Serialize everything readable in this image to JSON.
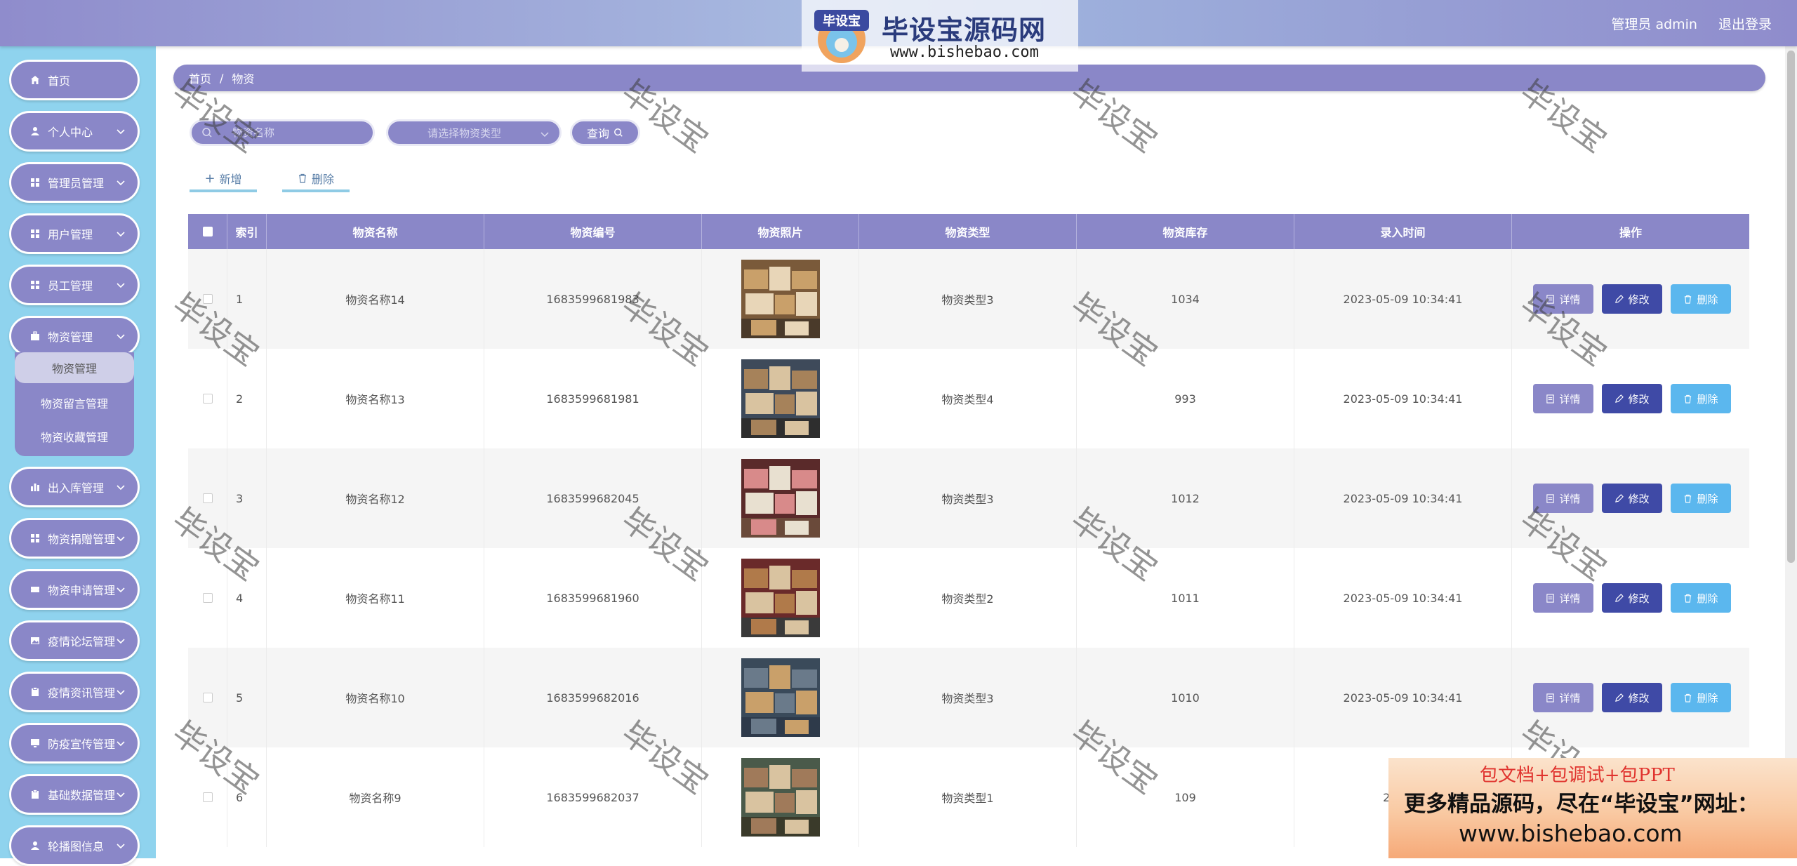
{
  "header": {
    "user_label": "管理员 admin",
    "logout_label": "退出登录",
    "logo_brand": "毕设宝源码网",
    "logo_url": "www.bishebao.com",
    "logo_badge": "毕设宝"
  },
  "sidebar": {
    "items": [
      {
        "label": "首页",
        "icon": "home-icon"
      },
      {
        "label": "个人中心",
        "icon": "user-icon"
      },
      {
        "label": "管理员管理",
        "icon": "grid-icon"
      },
      {
        "label": "用户管理",
        "icon": "grid-icon"
      },
      {
        "label": "员工管理",
        "icon": "grid-icon"
      },
      {
        "label": "物资管理",
        "icon": "briefcase-icon"
      },
      {
        "label": "出入库管理",
        "icon": "bar-chart-icon"
      },
      {
        "label": "物资捐赠管理",
        "icon": "grid-icon"
      },
      {
        "label": "物资申请管理",
        "icon": "ticket-icon"
      },
      {
        "label": "疫情论坛管理",
        "icon": "picture-icon"
      },
      {
        "label": "疫情资讯管理",
        "icon": "clipboard-icon"
      },
      {
        "label": "防疫宣传管理",
        "icon": "monitor-icon"
      },
      {
        "label": "基础数据管理",
        "icon": "clipboard-icon"
      },
      {
        "label": "轮播图信息",
        "icon": "user-icon"
      }
    ],
    "submenu": [
      {
        "label": "物资管理"
      },
      {
        "label": "物资留言管理"
      },
      {
        "label": "物资收藏管理"
      }
    ]
  },
  "breadcrumb": {
    "home": "首页",
    "separator": "/",
    "current": "物资"
  },
  "search": {
    "name_placeholder": "物资名称",
    "type_placeholder": "请选择物资类型",
    "query_label": "查询"
  },
  "actions": {
    "add_label": "新增",
    "delete_label": "删除"
  },
  "table": {
    "columns": [
      "索引",
      "物资名称",
      "物资编号",
      "物资照片",
      "物资类型",
      "物资库存",
      "录入时间",
      "操作"
    ],
    "buttons": {
      "detail": "详情",
      "edit": "修改",
      "delete": "删除"
    },
    "rows": [
      {
        "index": "1",
        "name": "物资名称14",
        "code": "1683599681983",
        "type": "物资类型3",
        "stock": "1034",
        "time": "2023-05-09 10:34:41"
      },
      {
        "index": "2",
        "name": "物资名称13",
        "code": "1683599681981",
        "type": "物资类型4",
        "stock": "993",
        "time": "2023-05-09 10:34:41"
      },
      {
        "index": "3",
        "name": "物资名称12",
        "code": "1683599682045",
        "type": "物资类型3",
        "stock": "1012",
        "time": "2023-05-09 10:34:41"
      },
      {
        "index": "4",
        "name": "物资名称11",
        "code": "1683599681960",
        "type": "物资类型2",
        "stock": "1011",
        "time": "2023-05-09 10:34:41"
      },
      {
        "index": "5",
        "name": "物资名称10",
        "code": "1683599682016",
        "type": "物资类型3",
        "stock": "1010",
        "time": "2023-05-09 10:34:41"
      },
      {
        "index": "6",
        "name": "物资名称9",
        "code": "1683599682037",
        "type": "物资类型1",
        "stock": "109",
        "time": "2023-0"
      }
    ]
  },
  "watermark": {
    "text": "毕设宝"
  },
  "ad": {
    "line1": "包文档+包调试+包PPT",
    "line2": "更多精品源码，尽在“毕设宝”网址：",
    "line3": "www.bishebao.com"
  },
  "colors": {
    "accent": "#8a87c8",
    "sidebar_bg": "#8fd3ee",
    "edit_btn": "#3f4aa6",
    "delete_btn": "#5bb7ee"
  }
}
